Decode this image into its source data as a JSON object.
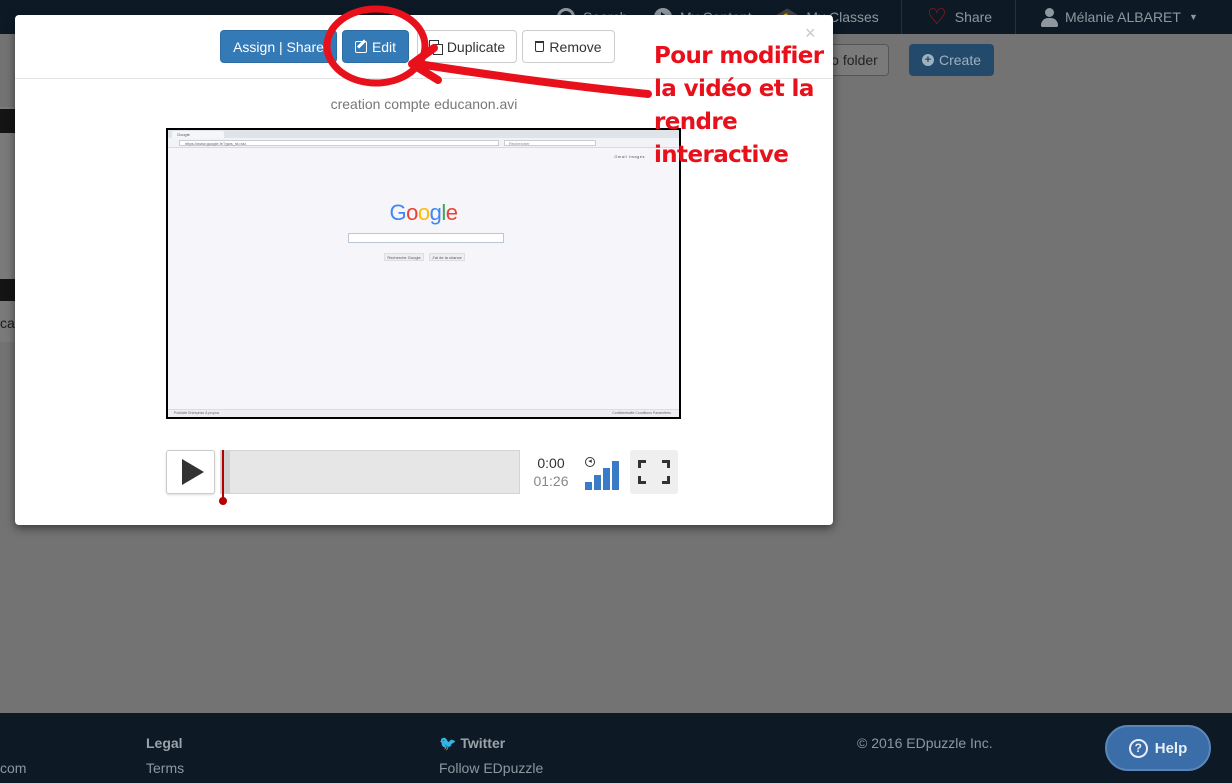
{
  "navbar": {
    "search": "Search",
    "my_content": "My Content",
    "my_classes": "My Classes",
    "share": "Share",
    "user": "Mélanie ALBARET"
  },
  "background": {
    "folder_button": "o folder",
    "create_button": "Create",
    "card_text": "cal"
  },
  "modal": {
    "assign_share": "Assign | Share",
    "edit": "Edit",
    "duplicate": "Duplicate",
    "remove": "Remove",
    "close": "×",
    "video_title": "creation compte educanon.avi"
  },
  "video_screen": {
    "tab_label": "Google",
    "url": "https://www.google.fr/?gws_rd=ssl",
    "search_placeholder": "Rechercher",
    "top_links": "Gmail  Images",
    "logo": "Google",
    "button_search": "Recherche Google",
    "button_lucky": "J'ai de la chance",
    "footer_left": "Publicité   Entreprise   À propos",
    "footer_right": "Confidentialité   Conditions   Paramètres"
  },
  "player": {
    "time_current": "0:00",
    "time_total": "01:26",
    "progress": 0.0,
    "volume_level": 4
  },
  "annotation": {
    "line1": "Pour modifier",
    "line2": "la vidéo et la",
    "line3": "rendre",
    "line4": "interactive"
  },
  "footer": {
    "left_text": "com",
    "legal_heading": "Legal",
    "terms": "Terms",
    "twitter_heading": "Twitter",
    "follow": "Follow EDpuzzle",
    "copyright": "© 2016 EDpuzzle Inc.",
    "help": "Help"
  },
  "colors": {
    "primary": "#337ab7",
    "annotation_red": "#e8101b",
    "navbar": "#0d1a26",
    "playhead": "#b30000"
  }
}
